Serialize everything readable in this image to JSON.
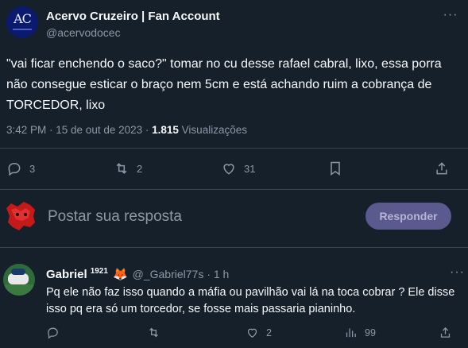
{
  "tweet": {
    "author": "Acervo Cruzeiro | Fan Account",
    "handle": "@acervodocec",
    "avatar_letters": "AC",
    "text": "\"vai ficar enchendo o saco?\" tomar no cu desse rafael cabral, lixo, essa porra não consegue esticar o braço nem 5cm e está achando ruim a cobrança de TORCEDOR, lixo",
    "time": "3:42 PM · 15 de out de 2023 · ",
    "views_count": "1.815",
    "views_label": " Visualizações",
    "more_icon": "more-icon",
    "actions": {
      "replies": "3",
      "retweets": "2",
      "likes": "31"
    }
  },
  "reply_box": {
    "placeholder": "Postar sua resposta",
    "button": "Responder",
    "button_color": "#5b5a8f"
  },
  "comment": {
    "name": "Gabriel",
    "superscript": "1921",
    "emoji": "🦊",
    "handle": "@_Gabriel77s",
    "time": "· 1 h",
    "text": "Pq ele não faz isso quando a máfia ou pavilhão vai lá na toca cobrar ? Ele disse isso pq era só um torcedor, se fosse mais passaria pianinho.",
    "actions": {
      "replies": "",
      "retweets": "",
      "likes": "2",
      "views": "99"
    }
  },
  "colors": {
    "background": "#15202b",
    "text": "#f7f9f9",
    "muted": "#8b98a5",
    "divider": "#38444d"
  }
}
